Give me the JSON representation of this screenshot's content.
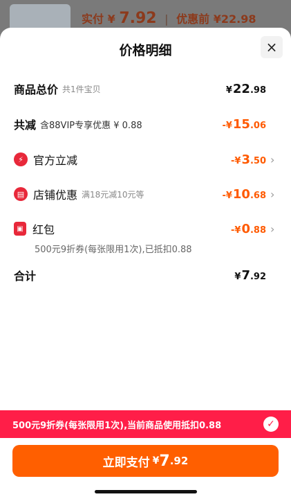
{
  "background": {
    "paid_label": "实付",
    "paid_yen": "¥",
    "paid_amount": "7.92",
    "separator": "|",
    "before_label": "优惠前",
    "before_amount": "¥22.98"
  },
  "sheet": {
    "title": "价格明细",
    "close_icon": "×"
  },
  "rows": {
    "total": {
      "label": "商品总价",
      "sub": "共1件宝贝",
      "yen": "¥",
      "int": "22",
      "dec": ".98"
    },
    "reduce": {
      "label": "共减",
      "sub": "含88VIP专享优惠 ¥ 0.88",
      "prefix": "-¥",
      "int": "15",
      "dec": ".06"
    },
    "official": {
      "label": "官方立减",
      "prefix": "-¥",
      "int": "3",
      "dec": ".50",
      "chevron": "›"
    },
    "store": {
      "label": "店铺优惠",
      "sub": "满18元减10元等",
      "prefix": "-¥",
      "int": "10",
      "dec": ".68",
      "chevron": "›"
    },
    "redpacket": {
      "label": "红包",
      "prefix": "-¥",
      "int": "0",
      "dec": ".88",
      "chevron": "›",
      "note": "500元9折券(每张限用1次),已抵扣0.88"
    },
    "sum": {
      "label": "合计",
      "yen": "¥",
      "int": "7",
      "dec": ".92"
    }
  },
  "banner": {
    "text": "500元9折券(每张限用1次),当前商品使用抵扣0.88",
    "check_icon": "✓"
  },
  "pay_button": {
    "label": "立即支付",
    "yen": "¥",
    "int": "7",
    "dec": ".92"
  },
  "colors": {
    "accent_orange": "#ff5f00",
    "discount_orange": "#ff5a00",
    "banner_red": "#ff1e48",
    "icon_red": "#e8283a"
  }
}
